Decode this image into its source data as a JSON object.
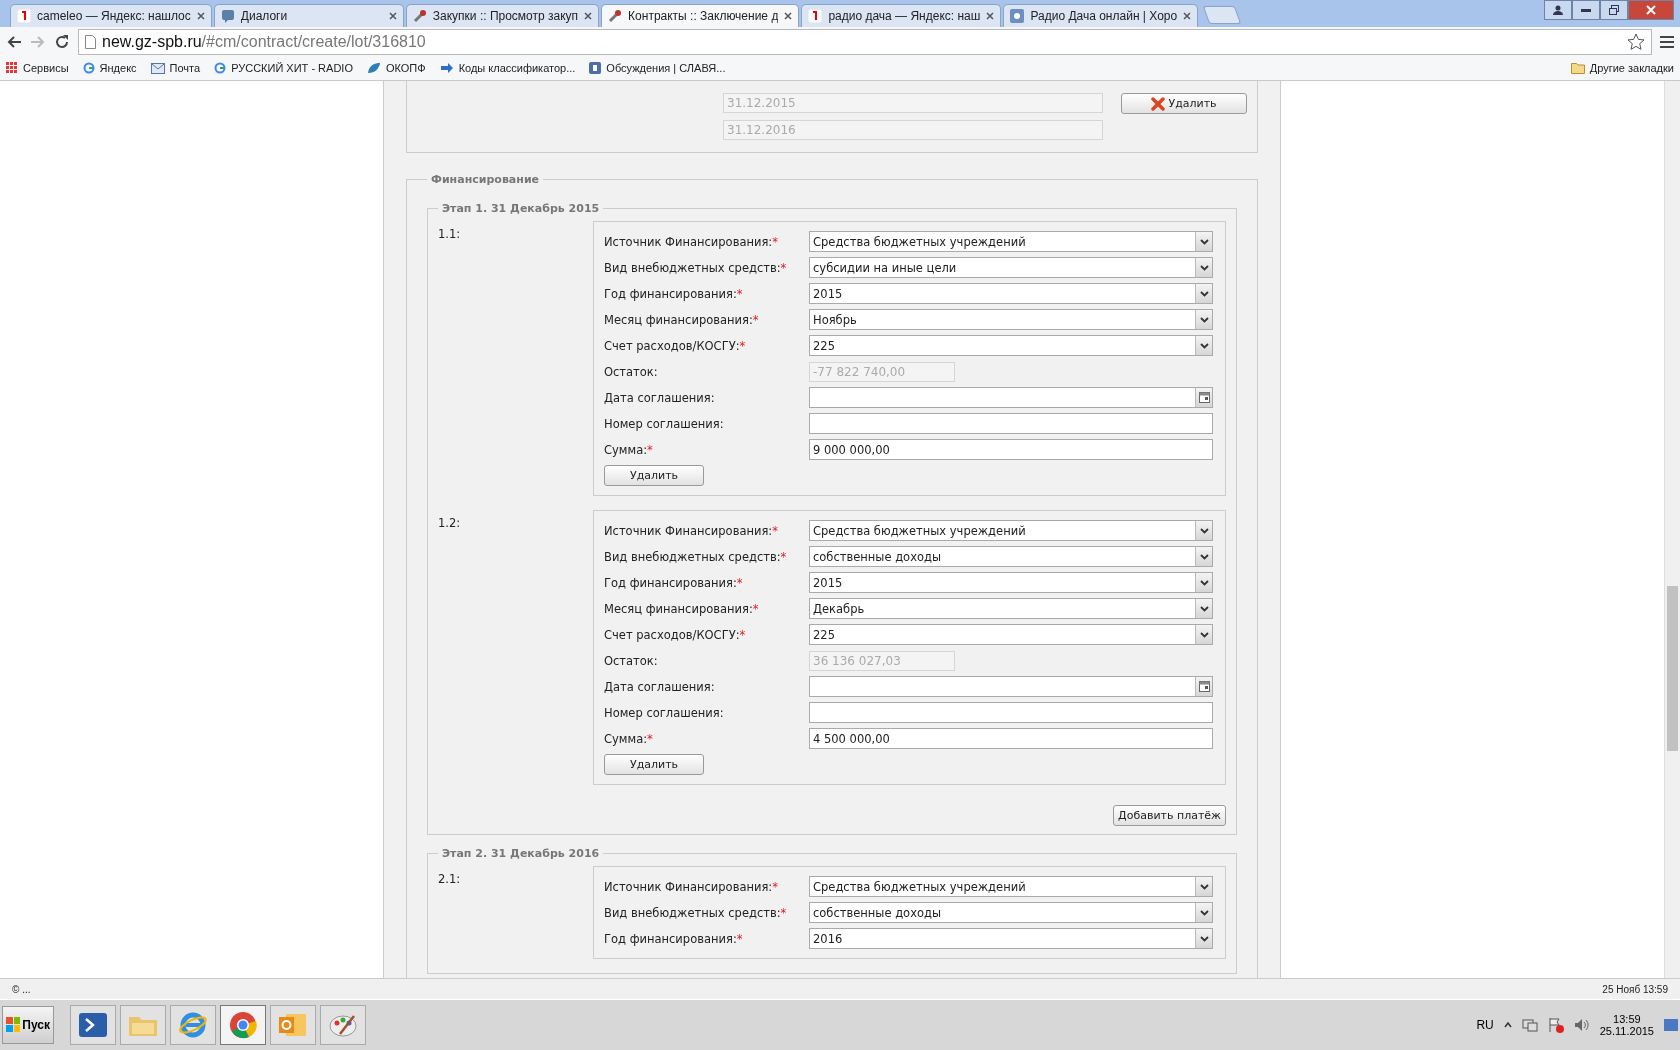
{
  "browser": {
    "tabs": [
      {
        "title": "cameleo — Яндекс: нашлос",
        "selected": false
      },
      {
        "title": "Диалоги",
        "selected": false
      },
      {
        "title": "Закупки :: Просмотр закуп",
        "selected": false
      },
      {
        "title": "Контракты :: Заключение д",
        "selected": true
      },
      {
        "title": "радио дача — Яндекс: наш",
        "selected": false
      },
      {
        "title": "Радио Дача онлайн | Хоро",
        "selected": false
      }
    ],
    "address": {
      "host": "new.gz-spb.ru",
      "path": "/#cm/contract/create/lot/316810"
    },
    "bookmarks": [
      {
        "title": "Сервисы"
      },
      {
        "title": "Яндекс"
      },
      {
        "title": "Почта"
      },
      {
        "title": "РУССКИЙ ХИТ - RADIO"
      },
      {
        "title": "ОКОПФ"
      },
      {
        "title": "Коды классификатор..."
      },
      {
        "title": "Обсуждения | СЛАВЯ..."
      }
    ],
    "other_bookmarks": "Другие закладки"
  },
  "top_section": {
    "dates": [
      "31.12.2015",
      "31.12.2016"
    ],
    "delete_button": "Удалить"
  },
  "financing": {
    "legend": "Финансирование",
    "stages": [
      {
        "legend": "Этап 1. 31 Декабрь 2015",
        "add_button": "Добавить платёж",
        "items": [
          {
            "label": "1.1:",
            "delete_button": "Удалить",
            "fields": [
              {
                "kind": "select",
                "label": "Источник Финансирования:",
                "mark": "*",
                "value": "Средства бюджетных учреждений"
              },
              {
                "kind": "select",
                "label": "Вид внебюджетных средств:",
                "mark": "*",
                "value": "субсидии на иные цели"
              },
              {
                "kind": "select",
                "label": "Год финансирования:",
                "mark": "*",
                "value": "2015"
              },
              {
                "kind": "select",
                "label": "Месяц финансирования:",
                "mark": "*",
                "value": "Ноябрь"
              },
              {
                "kind": "select",
                "label": "Счет расходов/КОСГУ:",
                "mark": "*",
                "value": "225"
              },
              {
                "kind": "readonly",
                "label": "Остаток:",
                "value": "-77 822 740,00"
              },
              {
                "kind": "date",
                "label": "Дата соглашения:"
              },
              {
                "kind": "text",
                "label": "Номер соглашения:"
              },
              {
                "kind": "text",
                "label": "Сумма:",
                "mark": "*",
                "value": "9 000 000,00"
              }
            ]
          },
          {
            "label": "1.2:",
            "delete_button": "Удалить",
            "fields": [
              {
                "kind": "select",
                "label": "Источник Финансирования:",
                "mark": "*",
                "value": "Средства бюджетных учреждений"
              },
              {
                "kind": "select",
                "label": "Вид внебюджетных средств:",
                "mark": "*",
                "value": "собственные доходы"
              },
              {
                "kind": "select",
                "label": "Год финансирования:",
                "mark": "*",
                "value": "2015"
              },
              {
                "kind": "select",
                "label": "Месяц финансирования:",
                "mark": "*",
                "value": "Декабрь"
              },
              {
                "kind": "select",
                "label": "Счет расходов/КОСГУ:",
                "mark": "*",
                "value": "225"
              },
              {
                "kind": "readonly",
                "label": "Остаток:",
                "value": "36 136 027,03"
              },
              {
                "kind": "date",
                "label": "Дата соглашения:"
              },
              {
                "kind": "text",
                "label": "Номер соглашения:"
              },
              {
                "kind": "text",
                "label": "Сумма:",
                "mark": "*",
                "value": "4 500 000,00"
              }
            ]
          }
        ]
      },
      {
        "legend": "Этап 2. 31 Декабрь 2016",
        "items": [
          {
            "label": "2.1:",
            "fields": [
              {
                "kind": "select",
                "label": "Источник Финансирования:",
                "mark": "*",
                "value": "Средства бюджетных учреждений"
              },
              {
                "kind": "select",
                "label": "Вид внебюджетных средств:",
                "mark": "*",
                "value": "собственные доходы"
              },
              {
                "kind": "select",
                "label": "Год финансирования:",
                "mark": "*",
                "value": "2016"
              }
            ]
          }
        ]
      }
    ]
  },
  "status_bar": {
    "left": "© ...",
    "right": "25 Нояб 13:59"
  },
  "taskbar": {
    "start": "Пуск",
    "apps": [
      {
        "selected": false
      },
      {
        "selected": false
      },
      {
        "selected": false
      },
      {
        "selected": true
      },
      {
        "selected": false
      },
      {
        "selected": false
      }
    ],
    "language": "RU",
    "time": "13:59",
    "date": "25.11.2015"
  }
}
